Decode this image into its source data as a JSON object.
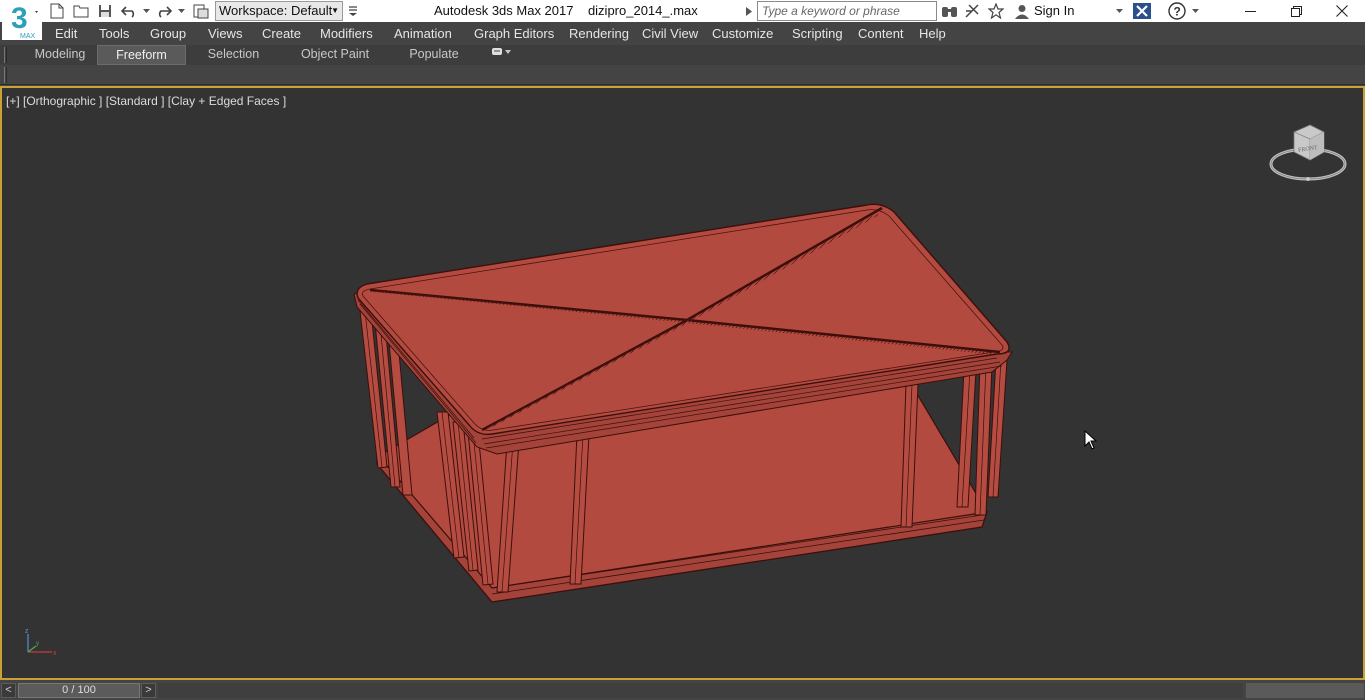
{
  "titlebar": {
    "workspace_label": "Workspace: Default",
    "app_name": "Autodesk 3ds Max 2017",
    "file_name": "dizipro_2014_.max",
    "search_placeholder": "Type a keyword or phrase",
    "sign_in": "Sign In",
    "logo_text": "MAX"
  },
  "menu": [
    "Edit",
    "Tools",
    "Group",
    "Views",
    "Create",
    "Modifiers",
    "Animation",
    "Graph Editors",
    "Rendering",
    "Civil View",
    "Customize",
    "Scripting",
    "Content",
    "Help"
  ],
  "ribbon": {
    "tabs": [
      "Modeling",
      "Freeform",
      "Selection",
      "Object Paint",
      "Populate"
    ],
    "active_tab": "Freeform"
  },
  "viewport": {
    "label": "[+] [Orthographic ] [Standard ] [Clay + Edged Faces ]",
    "viewcube_face": "FRONT",
    "model_color": "#b34a40",
    "border_color": "#c8a235"
  },
  "timeline": {
    "frame_display": "0 / 100",
    "prev": "<",
    "next": ">"
  },
  "colors": {
    "ui_dark": "#444444",
    "viewport_bg": "#333333",
    "titlebar_bg": "#ffffff"
  }
}
